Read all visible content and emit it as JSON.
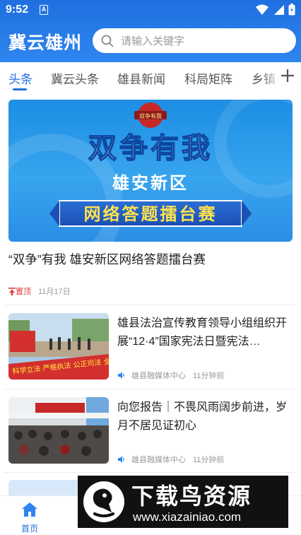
{
  "status_bar": {
    "time": "9:52",
    "notif_letter": "A"
  },
  "header": {
    "app_title": "冀云雄州",
    "search_placeholder": "请输入关键字"
  },
  "tabs": [
    {
      "label": "头条",
      "active": true
    },
    {
      "label": "冀云头条"
    },
    {
      "label": "雄县新闻"
    },
    {
      "label": "科局矩阵"
    },
    {
      "label": "乡镇"
    }
  ],
  "featured": {
    "banner": {
      "emblem_text": "双争有我",
      "title": "双争有我",
      "subtitle": "雄安新区",
      "ribbon": "网络答题擂台赛"
    },
    "headline": "“双争”有我 雄安新区网络答题擂台赛",
    "pinned_label": "置顶",
    "date": "11月17日"
  },
  "news": [
    {
      "title": "雄县法治宣传教育领导小组组织开展“12·4”国家宪法日暨宪法…",
      "source": "雄县融媒体中心",
      "time_ago": "11分钟前",
      "thumb_banner_text": "科学立法 严格执法 公正司法 全民守法"
    },
    {
      "title": "向您报告｜不畏风雨阔步前进，岁月不居见证初心",
      "source": "雄县融媒体中心",
      "time_ago": "11分钟前"
    }
  ],
  "bottom_nav": [
    {
      "label": "首页",
      "active": true
    }
  ],
  "watermark": {
    "title": "下载鸟资源",
    "url": "www.xiazainiao.com"
  },
  "colors": {
    "brand_blue": "#1f6fe0",
    "pin_red": "#e53935",
    "meta_gray": "#999999"
  },
  "icons": [
    "search-icon",
    "wifi-icon",
    "signal-icon",
    "battery-icon",
    "plus-icon",
    "speaker-icon",
    "pin-icon",
    "home-icon"
  ]
}
